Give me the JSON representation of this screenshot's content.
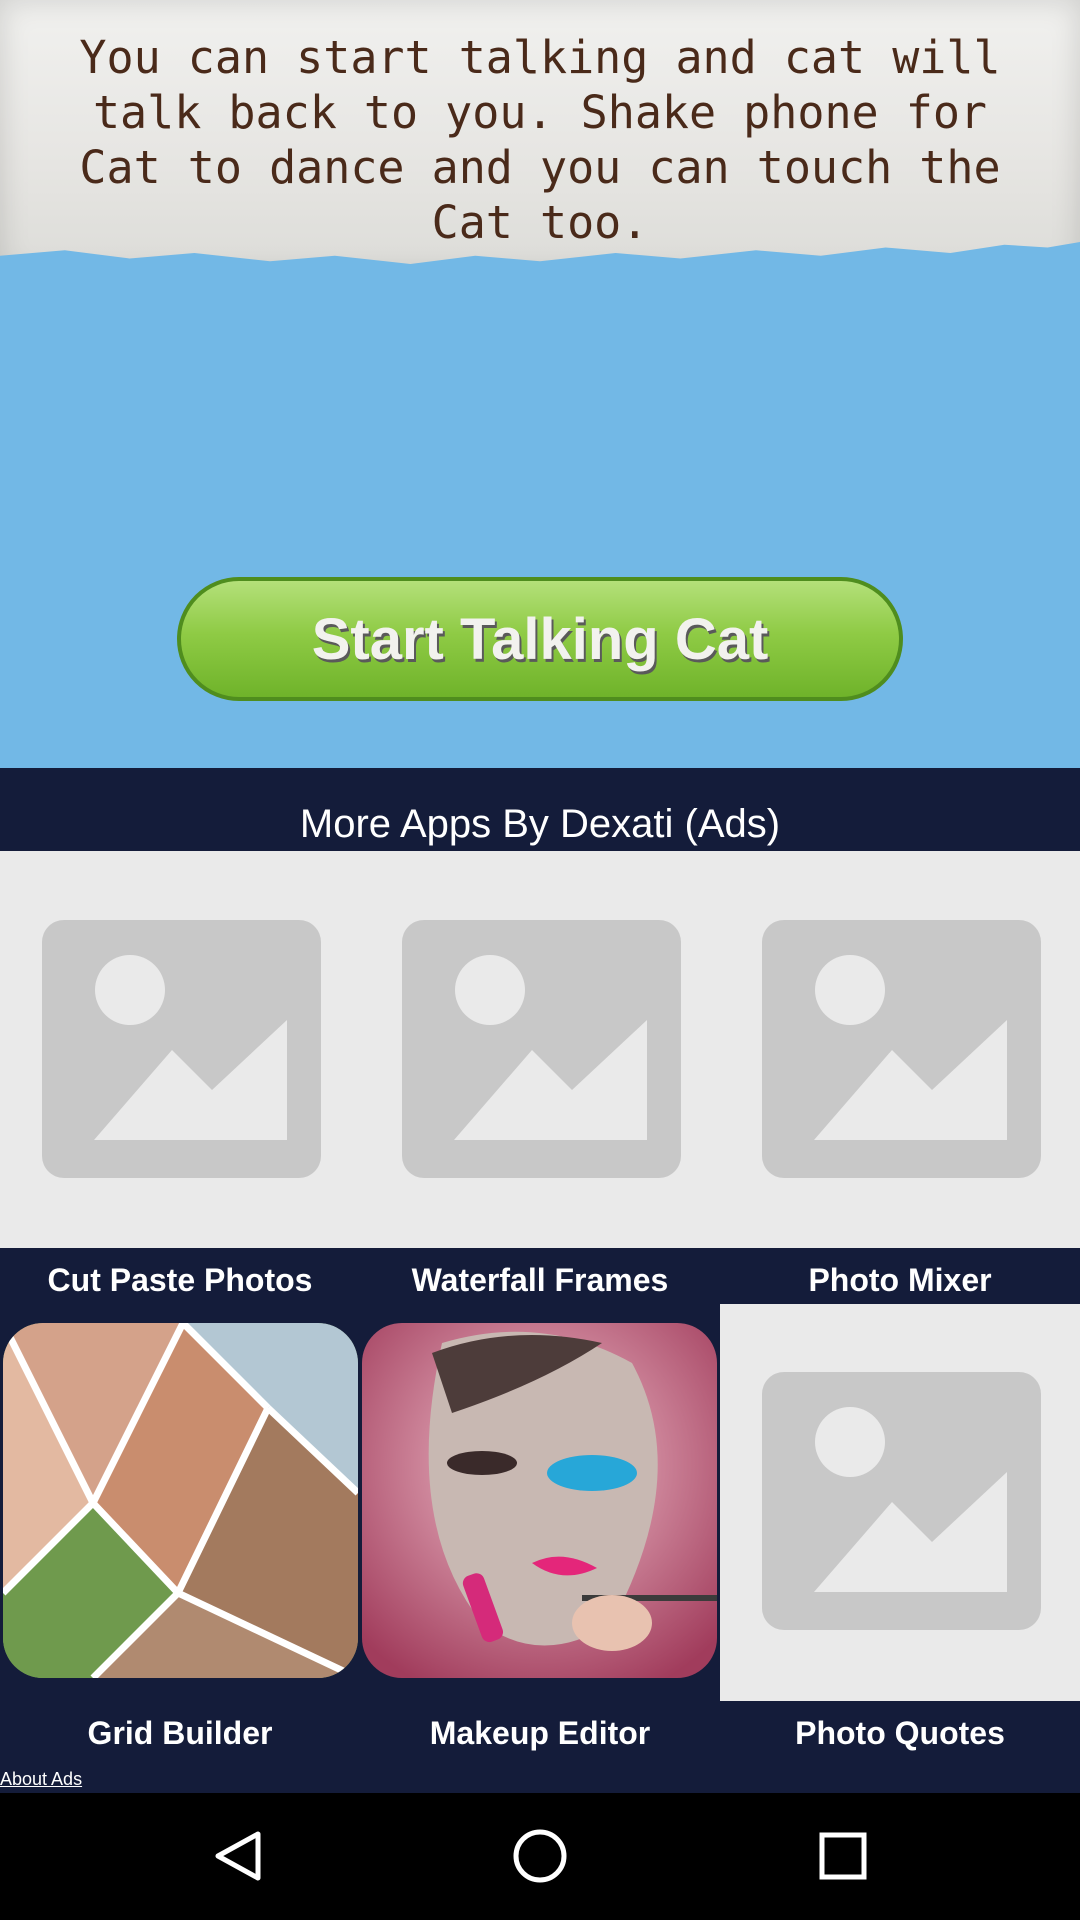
{
  "banner": {
    "text": "You can start talking and cat will talk back to you. Shake phone for Cat to dance and you can touch the Cat too."
  },
  "start_button": {
    "label": "Start Talking Cat"
  },
  "ads": {
    "title": "More Apps By Dexati (Ads)",
    "apps_row1": [
      {
        "name": "Cut Paste Photos"
      },
      {
        "name": "Waterfall Frames"
      },
      {
        "name": "Photo Mixer"
      }
    ],
    "apps_row2": [
      {
        "name": "Grid Builder"
      },
      {
        "name": "Makeup Editor"
      },
      {
        "name": "Photo Quotes"
      }
    ],
    "about_link": "About Ads"
  },
  "navbar": {
    "icons": [
      "back-icon",
      "home-icon",
      "recents-icon"
    ]
  }
}
